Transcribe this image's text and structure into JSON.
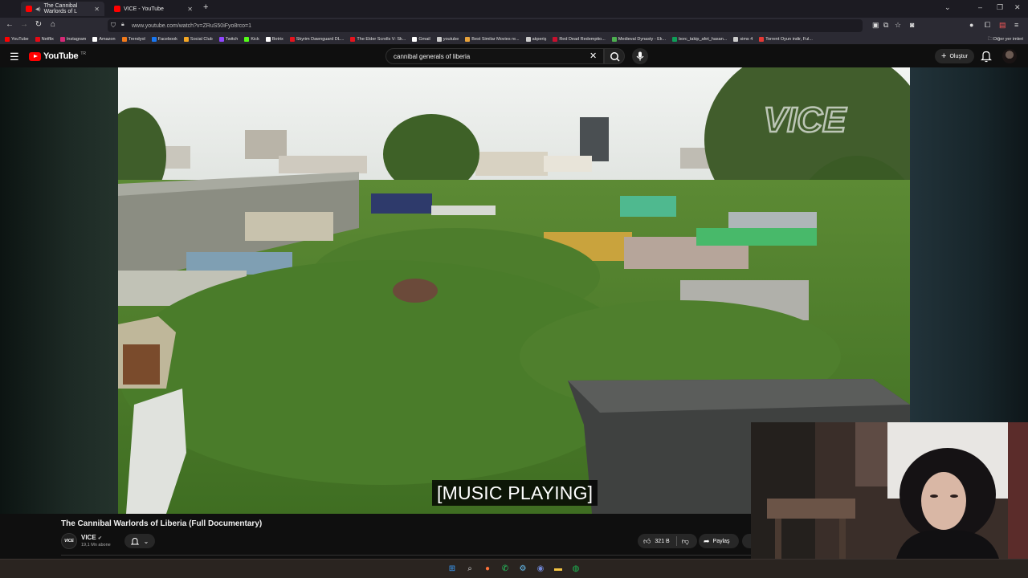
{
  "browser": {
    "tabs": [
      {
        "title": "The Cannibal Warlords of L",
        "active": true
      },
      {
        "title": "VICE - YouTube",
        "active": false
      }
    ],
    "new_tab": "+",
    "url": "www.youtube.com/watch?v=ZRuS50iFyo8rco=1",
    "window_controls": [
      "–",
      "❐",
      "✕"
    ]
  },
  "bookmarks": [
    {
      "label": "YouTube",
      "color": "#ff0000"
    },
    {
      "label": "Netflix",
      "color": "#e50914"
    },
    {
      "label": "Instagram",
      "color": "#d62976"
    },
    {
      "label": "Amazon",
      "color": "#ffffff"
    },
    {
      "label": "Trendyol",
      "color": "#f27a1a"
    },
    {
      "label": "Facebook",
      "color": "#1877f2"
    },
    {
      "label": "Social Club",
      "color": "#f5a623"
    },
    {
      "label": "Twitch",
      "color": "#9146ff"
    },
    {
      "label": "Kick",
      "color": "#53fc18"
    },
    {
      "label": "Botrix",
      "color": "#ffffff"
    },
    {
      "label": "Skyrim Dawnguard DL...",
      "color": "#e5141e"
    },
    {
      "label": "The Elder Scrolls V: Sk...",
      "color": "#e5141e"
    },
    {
      "label": "Gmail",
      "color": "#ffffff"
    },
    {
      "label": "youtube",
      "color": "#cccccc"
    },
    {
      "label": "Best Similar Movies re...",
      "color": "#e8a23a"
    },
    {
      "label": "akperiş",
      "color": "#cccccc"
    },
    {
      "label": "Red Dead Redemptio...",
      "color": "#c8102e"
    },
    {
      "label": "Medieval Dynasty - Ek...",
      "color": "#4caf50"
    },
    {
      "label": "borc_takip_afet_hasan...",
      "color": "#0f9d58"
    },
    {
      "label": "sims 4",
      "color": "#cccccc"
    },
    {
      "label": "Torrent Oyun indir, Ful...",
      "color": "#e53935"
    }
  ],
  "bookmarks_other": "Diğer yer imleri",
  "youtube": {
    "logo_text": "YouTube",
    "country_code": "TR",
    "search_query": "cannibal generals of liberia",
    "create_label": "Oluştur"
  },
  "video": {
    "subtitle": "[MUSIC PLAYING]",
    "watermark": "VICE",
    "title": "The Cannibal Warlords of Liberia (Full Documentary)",
    "channel_name": "VICE",
    "channel_subs": "19,1 Mn abone",
    "likes": "321 B",
    "share_label": "Paylaş"
  },
  "icons": {
    "menu": "menu-icon",
    "search": "search-icon",
    "mic": "mic-icon",
    "bell": "bell-icon"
  }
}
